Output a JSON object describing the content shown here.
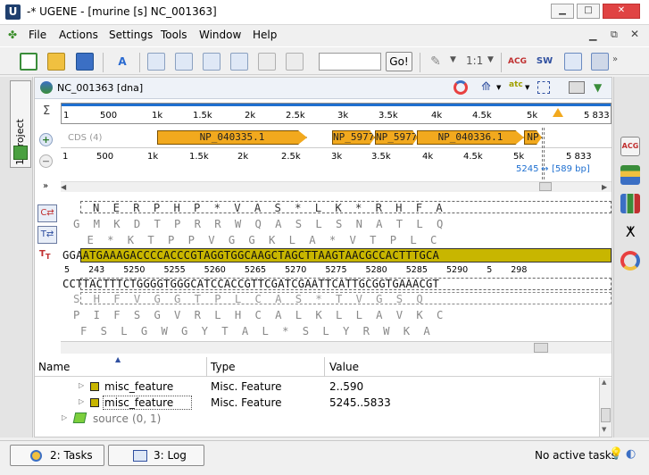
{
  "window": {
    "title": "-* UGENE - [murine [s] NC_001363]"
  },
  "menu": [
    "File",
    "Actions",
    "Settings",
    "Tools",
    "Window",
    "Help"
  ],
  "toolbar": {
    "go_label": "Go!",
    "zoom_ratio": "1:1"
  },
  "left_panel": {
    "project_tab": "1: Project"
  },
  "sequence": {
    "name": "NC_001363 [dna]",
    "ruler_ticks": [
      "1",
      "500",
      "1k",
      "1.5k",
      "2k",
      "2.5k",
      "3k",
      "3.5k",
      "4k",
      "4.5k",
      "5k",
      "5 833"
    ],
    "track_label": "CDS (4)",
    "features": [
      "NP_040335.1",
      "NP_5977",
      "NP_5977",
      "NP_040336.1",
      "NP"
    ],
    "selection_start": "5245",
    "selection_len": "[589 bp]",
    "details_ticks": [
      "5 243",
      "5250",
      "5255",
      "5260",
      "5265",
      "5270",
      "5275",
      "5280",
      "5285",
      "5290",
      "5 298"
    ],
    "trans_top": "N  E  R  P  H  P  *  V  A  S  *  L  K  *  R  H  F  A",
    "frame1": "G  M  K  D  T  P  R  R  W  Q  A  S  L  S  N  A  T  L  Q",
    "frame2": " E  *  K  T  P  P  V  G  G  K  L  A  *  V  T  P  L  C ",
    "direct": "GGAATGAAAGACCCCACCCGTAGGTGGCAAGCTAGCTTAAGTAACGCCACTTTGCA",
    "complement": "CCTTACTTTCTGGGGTGGGCATCCACCGTTCGATCGAATTCATTGCGGTGAAACGT",
    "rframe1": "S  H  F  V  G  G  T  P  L  C  A  S  *  T  V  G  S  Q",
    "rframe2": "P  I  F  S  G  V  R  L  H  C  A  L  K  L  L  A  V  K  C",
    "rframe3": "F  S  L  G  W  G  Y  T  A  L  *  S  L  Y  R  W  K  A"
  },
  "annotations": {
    "columns": [
      "Name",
      "Type",
      "Value"
    ],
    "rows": [
      {
        "name": "misc_feature",
        "type": "Misc. Feature",
        "value": "2..590"
      },
      {
        "name": "misc_feature",
        "type": "Misc. Feature",
        "value": "5245..5833"
      }
    ],
    "source_label": "source",
    "source_count": "(0, 1)"
  },
  "status": {
    "tasks_button": "2: Tasks",
    "log_button": "3: Log",
    "message": "No active tasks"
  },
  "colors": {
    "feature": "#f2a91e",
    "selection": "#c8b600",
    "accent": "#1e6fd0"
  }
}
